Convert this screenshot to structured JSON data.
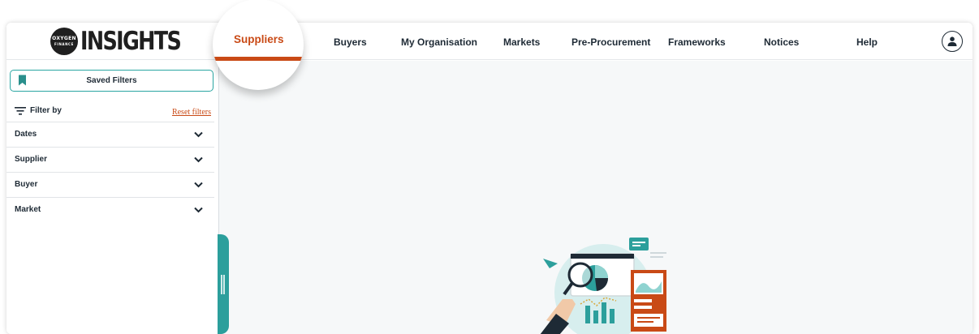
{
  "logo": {
    "circle_line1": "OXYGEN",
    "circle_line2": "FINANCE",
    "word": "INSIGHTS"
  },
  "nav": {
    "items": [
      {
        "label": "Suppliers",
        "active": true
      },
      {
        "label": "Buyers"
      },
      {
        "label": "My Organisation"
      },
      {
        "label": "Markets"
      },
      {
        "label": "Pre-Procurement"
      },
      {
        "label": "Frameworks"
      },
      {
        "label": "Notices"
      },
      {
        "label": "Help"
      }
    ]
  },
  "sidebar": {
    "saved_filters_label": "Saved Filters",
    "filter_by_label": "Filter by",
    "reset_label": "Reset filters",
    "sections": [
      {
        "label": "Dates"
      },
      {
        "label": "Supplier"
      },
      {
        "label": "Buyer"
      },
      {
        "label": "Market"
      }
    ]
  },
  "icons": {
    "bookmark": "bookmark-icon",
    "filter": "filter-icon",
    "chevron": "chevron-down-icon",
    "user": "user-icon",
    "illustration": "data-analysis-illustration"
  },
  "colors": {
    "accent_orange": "#c94a16",
    "teal": "#2aa6a2",
    "text_dark": "#1e2a35"
  }
}
